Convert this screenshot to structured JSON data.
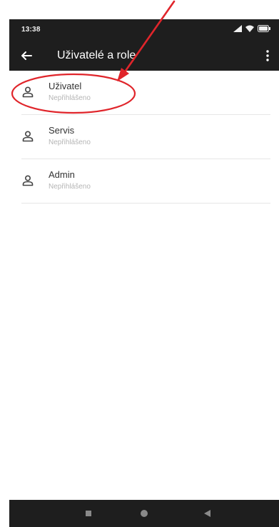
{
  "status_bar": {
    "time": "13:38"
  },
  "app_bar": {
    "title": "Uživatelé a role"
  },
  "users": [
    {
      "name": "Uživatel",
      "status": "Nepřihlášeno"
    },
    {
      "name": "Servis",
      "status": "Nepřihlášeno"
    },
    {
      "name": "Admin",
      "status": "Nepřihlášeno"
    }
  ],
  "colors": {
    "bar_background": "#1e1e1e",
    "annotation_red": "#e0252b"
  },
  "icons": {
    "back": "arrow-left-icon",
    "menu": "more-vert-icon",
    "user": "person-icon",
    "signal": "signal-icon",
    "wifi": "wifi-icon",
    "battery": "battery-icon",
    "nav_recent": "square-icon",
    "nav_home": "circle-icon",
    "nav_back": "triangle-back-icon"
  }
}
